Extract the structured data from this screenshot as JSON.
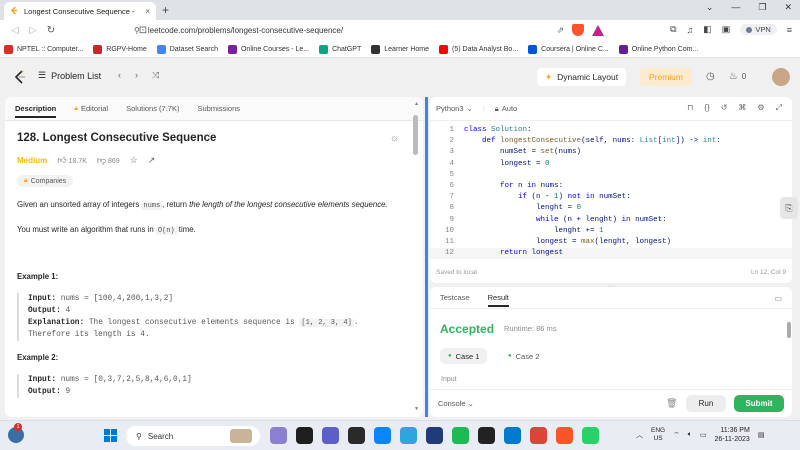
{
  "browser": {
    "tab_title": "Longest Consecutive Sequence -",
    "tab_close": "×",
    "new_tab": "+",
    "url": "leetcode.com/problems/longest-consecutive-sequence/",
    "vpn": "VPN",
    "bookmarks": [
      "NPTEL :: Computer...",
      "RGPV-Home",
      "Dataset Search",
      "Online Courses - Le...",
      "ChatGPT",
      "Learner Home",
      "(5) Data Analyst Bo...",
      "Coursera | Online C...",
      "Online Python Com..."
    ],
    "bookmark_colors": [
      "#d93025",
      "#c62828",
      "#4285f4",
      "#7b1fa2",
      "#10a37f",
      "#333333",
      "#ff0000",
      "#0056d2",
      "#6a1b9a"
    ]
  },
  "header": {
    "problem_list": "Problem List",
    "dynamic_layout": "Dynamic Layout",
    "premium": "Premium",
    "streak": "0"
  },
  "left": {
    "tabs": [
      "Description",
      "Editorial",
      "Solutions (7.7K)",
      "Submissions"
    ],
    "title": "128. Longest Consecutive Sequence",
    "difficulty": "Medium",
    "likes": "18.7K",
    "dislikes": "869",
    "companies": "Companies",
    "desc_a": "Given an unsorted array of integers ",
    "desc_code": "nums",
    "desc_b": ", return ",
    "desc_it": "the length of the longest consecutive elements sequence.",
    "algo_a": "You must write an algorithm that runs in ",
    "algo_code": "O(n)",
    "algo_b": " time.",
    "ex1_title": "Example 1:",
    "ex1_input_lbl": "Input:",
    "ex1_input": " nums = [100,4,200,1,3,2]",
    "ex1_output_lbl": "Output:",
    "ex1_output": " 4",
    "ex1_expl_lbl": "Explanation:",
    "ex1_expl": " The longest consecutive elements sequence is ",
    "ex1_expl_code": "[1, 2, 3, 4]",
    "ex1_expl_end": ".",
    "ex1_expl2": "Therefore its length is 4.",
    "ex2_title": "Example 2:",
    "ex2_input_lbl": "Input:",
    "ex2_input": " nums = [0,3,7,2,5,8,4,6,0,1]",
    "ex2_output_lbl": "Output:",
    "ex2_output": " 9"
  },
  "editor": {
    "language": "Python3",
    "mode": "Auto",
    "lines": [
      {
        "n": "1",
        "html": "<span class='k'>class</span> <span class='t'>Solution</span>:"
      },
      {
        "n": "2",
        "html": "    <span class='k'>def</span> <span class='f'>longestConsecutive</span>(<span class='v'>self</span>, <span class='v'>nums</span>: <span class='t'>List</span>[<span class='t'>int</span>]) -> <span class='t'>int</span>:"
      },
      {
        "n": "3",
        "html": "        numSet = <span class='f'>set</span>(nums)"
      },
      {
        "n": "4",
        "html": "        longest = <span class='n'>0</span>"
      },
      {
        "n": "5",
        "html": ""
      },
      {
        "n": "6",
        "html": "        <span class='k'>for</span> n <span class='k'>in</span> nums:"
      },
      {
        "n": "7",
        "html": "            <span class='k'>if</span> (n - <span class='n'>1</span>) <span class='k'>not in</span> numSet:"
      },
      {
        "n": "8",
        "html": "                lenght = <span class='n'>0</span>"
      },
      {
        "n": "9",
        "html": "                <span class='k'>while</span> (n + lenght) <span class='k'>in</span> numSet:"
      },
      {
        "n": "10",
        "html": "                    lenght += <span class='n'>1</span>"
      },
      {
        "n": "11",
        "html": "                longest = <span class='f'>max</span>(lenght, longest)"
      },
      {
        "n": "12",
        "html": "        <span class='k'>return</span> longest"
      }
    ],
    "saved": "Saved to local",
    "cursor": "Ln 12, Col 9"
  },
  "tests": {
    "tabs": [
      "Testcase",
      "Result"
    ],
    "status": "Accepted",
    "runtime": "Runtime: 86 ms",
    "case1": "Case 1",
    "case2": "Case 2",
    "input_label": "Input",
    "console": "Console",
    "run": "Run",
    "submit": "Submit"
  },
  "taskbar": {
    "search": "Search",
    "badge": "1",
    "lang": "ENG",
    "region": "US",
    "time": "11:36 PM",
    "date": "26-11-2023",
    "app_colors": [
      "#8a7fd1",
      "#1e1e1e",
      "#5b5fc7",
      "#2a2a2a",
      "#0a84ff",
      "#2ea6dd",
      "#1f3b7a",
      "#1db954",
      "#222222",
      "#007acc",
      "#db4437",
      "#fb542b",
      "#25d366"
    ]
  },
  "colors": {
    "accent_green": "#2db55d",
    "medium_yellow": "#ffb800",
    "leetcode_orange": "#ffa116",
    "split_blue": "#3b82f6"
  }
}
